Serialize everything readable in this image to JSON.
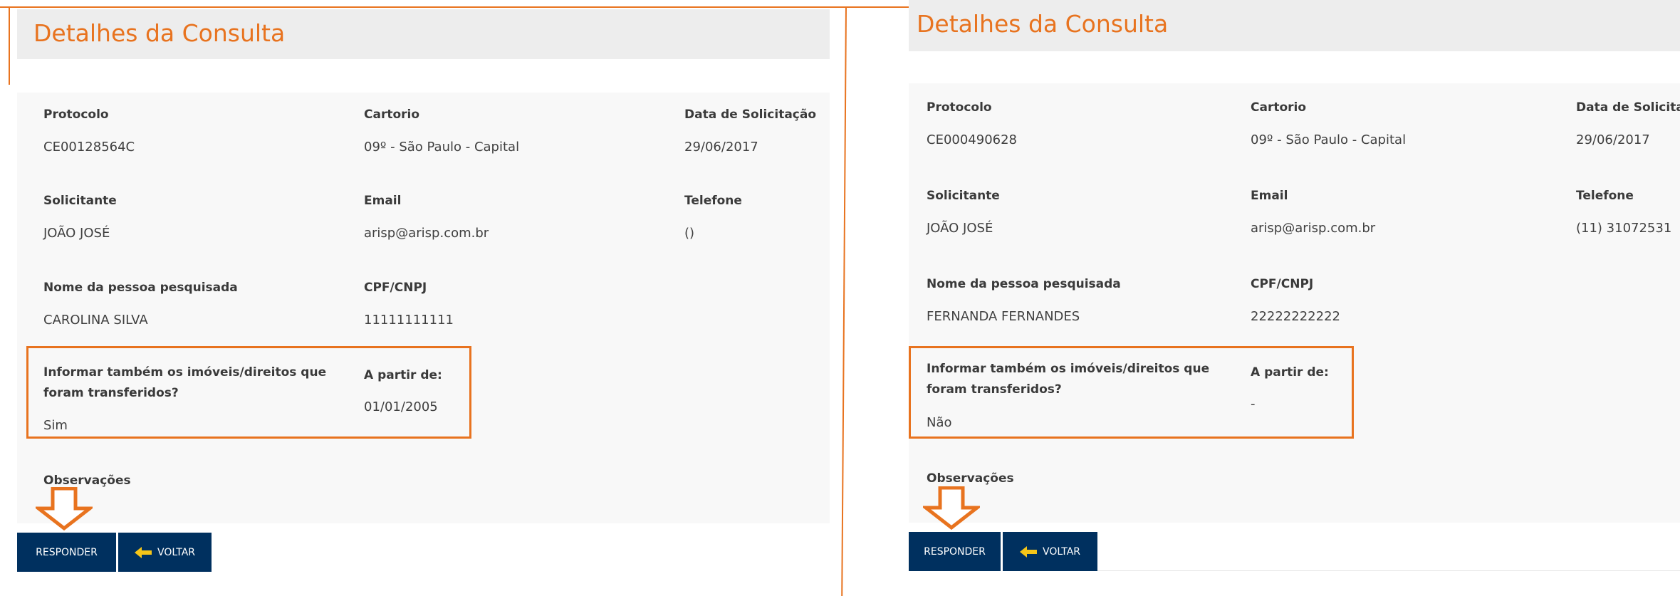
{
  "colors": {
    "accent": "#e8731f",
    "button_bg": "#00305f",
    "title_bar_bg": "#ededed",
    "details_bg": "#f8f8f8",
    "arrow_icon": "#f5c518"
  },
  "panels": [
    {
      "title": "Detalhes da Consulta",
      "fields": {
        "protocolo": {
          "label": "Protocolo",
          "value": "CE00128564C"
        },
        "cartorio": {
          "label": "Cartorio",
          "value": "09º - São Paulo - Capital"
        },
        "data": {
          "label": "Data de Solicitação",
          "value": "29/06/2017"
        },
        "solicitante": {
          "label": "Solicitante",
          "value": "JOÃO JOSÉ"
        },
        "email": {
          "label": "Email",
          "value": "arisp@arisp.com.br"
        },
        "telefone": {
          "label": "Telefone",
          "value": "()"
        },
        "nome": {
          "label": "Nome da pessoa pesquisada",
          "value": "CAROLINA SILVA"
        },
        "cpf": {
          "label": "CPF/CNPJ",
          "value": "11111111111"
        },
        "informar": {
          "label": "Informar também os imóveis/direitos que foram transferidos?",
          "value": "Sim"
        },
        "apartir": {
          "label": "A partir de:",
          "value": "01/01/2005"
        },
        "observacoes": {
          "label": "Observações"
        }
      },
      "buttons": {
        "responder": "RESPONDER",
        "voltar": "VOLTAR"
      }
    },
    {
      "title": "Detalhes da Consulta",
      "fields": {
        "protocolo": {
          "label": "Protocolo",
          "value": "CE000490628"
        },
        "cartorio": {
          "label": "Cartorio",
          "value": "09º - São Paulo - Capital"
        },
        "data": {
          "label": "Data de Solicitação",
          "value": "29/06/2017"
        },
        "solicitante": {
          "label": "Solicitante",
          "value": "JOÃO JOSÉ"
        },
        "email": {
          "label": "Email",
          "value": "arisp@arisp.com.br"
        },
        "telefone": {
          "label": "Telefone",
          "value": "(11) 31072531"
        },
        "nome": {
          "label": "Nome da pessoa pesquisada",
          "value": "FERNANDA FERNANDES"
        },
        "cpf": {
          "label": "CPF/CNPJ",
          "value": "22222222222"
        },
        "informar": {
          "label": "Informar também os imóveis/direitos que foram transferidos?",
          "value": "Não"
        },
        "apartir": {
          "label": "A partir de:",
          "value": "-"
        },
        "observacoes": {
          "label": "Observações"
        }
      },
      "buttons": {
        "responder": "RESPONDER",
        "voltar": "VOLTAR"
      }
    }
  ]
}
